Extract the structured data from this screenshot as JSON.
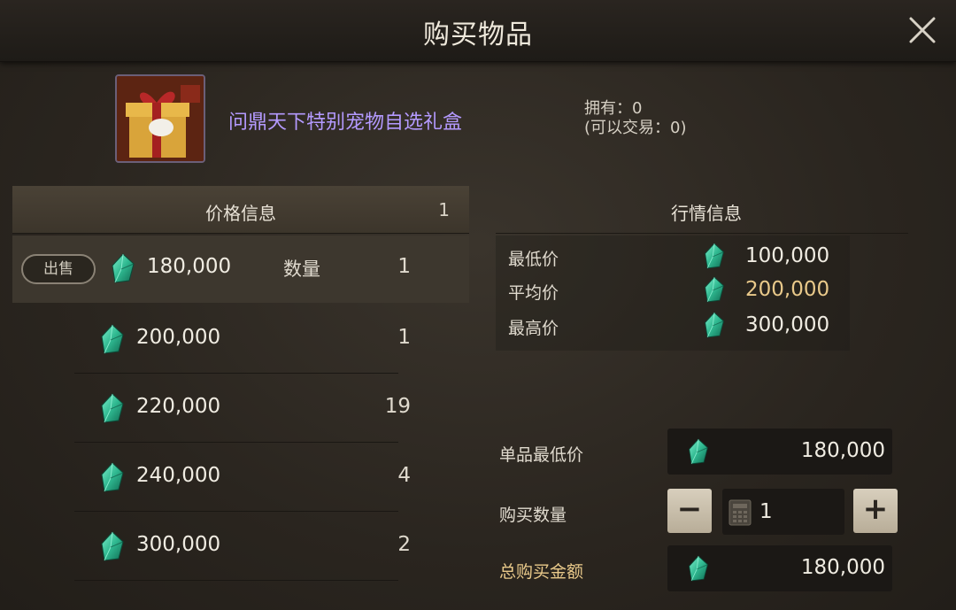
{
  "window": {
    "title": "购买物品",
    "close_icon": "close-icon"
  },
  "item": {
    "name": "问鼎天下特别宠物自选礼盒",
    "name_color": "#b49aff",
    "owned_text": "拥有：0",
    "tradable_text": "(可以交易：0)",
    "icon": "gift-box-icon"
  },
  "price_panel": {
    "title": "价格信息",
    "count": "1",
    "sell_label": "出售",
    "quantity_label": "数量",
    "listings": [
      {
        "price": "180,000",
        "qty": "1"
      },
      {
        "price": "200,000",
        "qty": "1"
      },
      {
        "price": "220,000",
        "qty": "19"
      },
      {
        "price": "240,000",
        "qty": "4"
      },
      {
        "price": "300,000",
        "qty": "2"
      }
    ]
  },
  "market_panel": {
    "title": "行情信息",
    "rows": [
      {
        "label": "最低价",
        "value": "100,000"
      },
      {
        "label": "平均价",
        "value": "200,000"
      },
      {
        "label": "最高价",
        "value": "300,000"
      }
    ]
  },
  "purchase": {
    "unit_min_label": "单品最低价",
    "unit_min_value": "180,000",
    "qty_label": "购买数量",
    "qty_value": "1",
    "minus_label": "−",
    "plus_label": "+",
    "total_label": "总购买金额",
    "total_value": "180,000"
  },
  "colors": {
    "gem": "#2fb890",
    "gold_text": "#e9c98a",
    "item_name": "#b49aff"
  }
}
